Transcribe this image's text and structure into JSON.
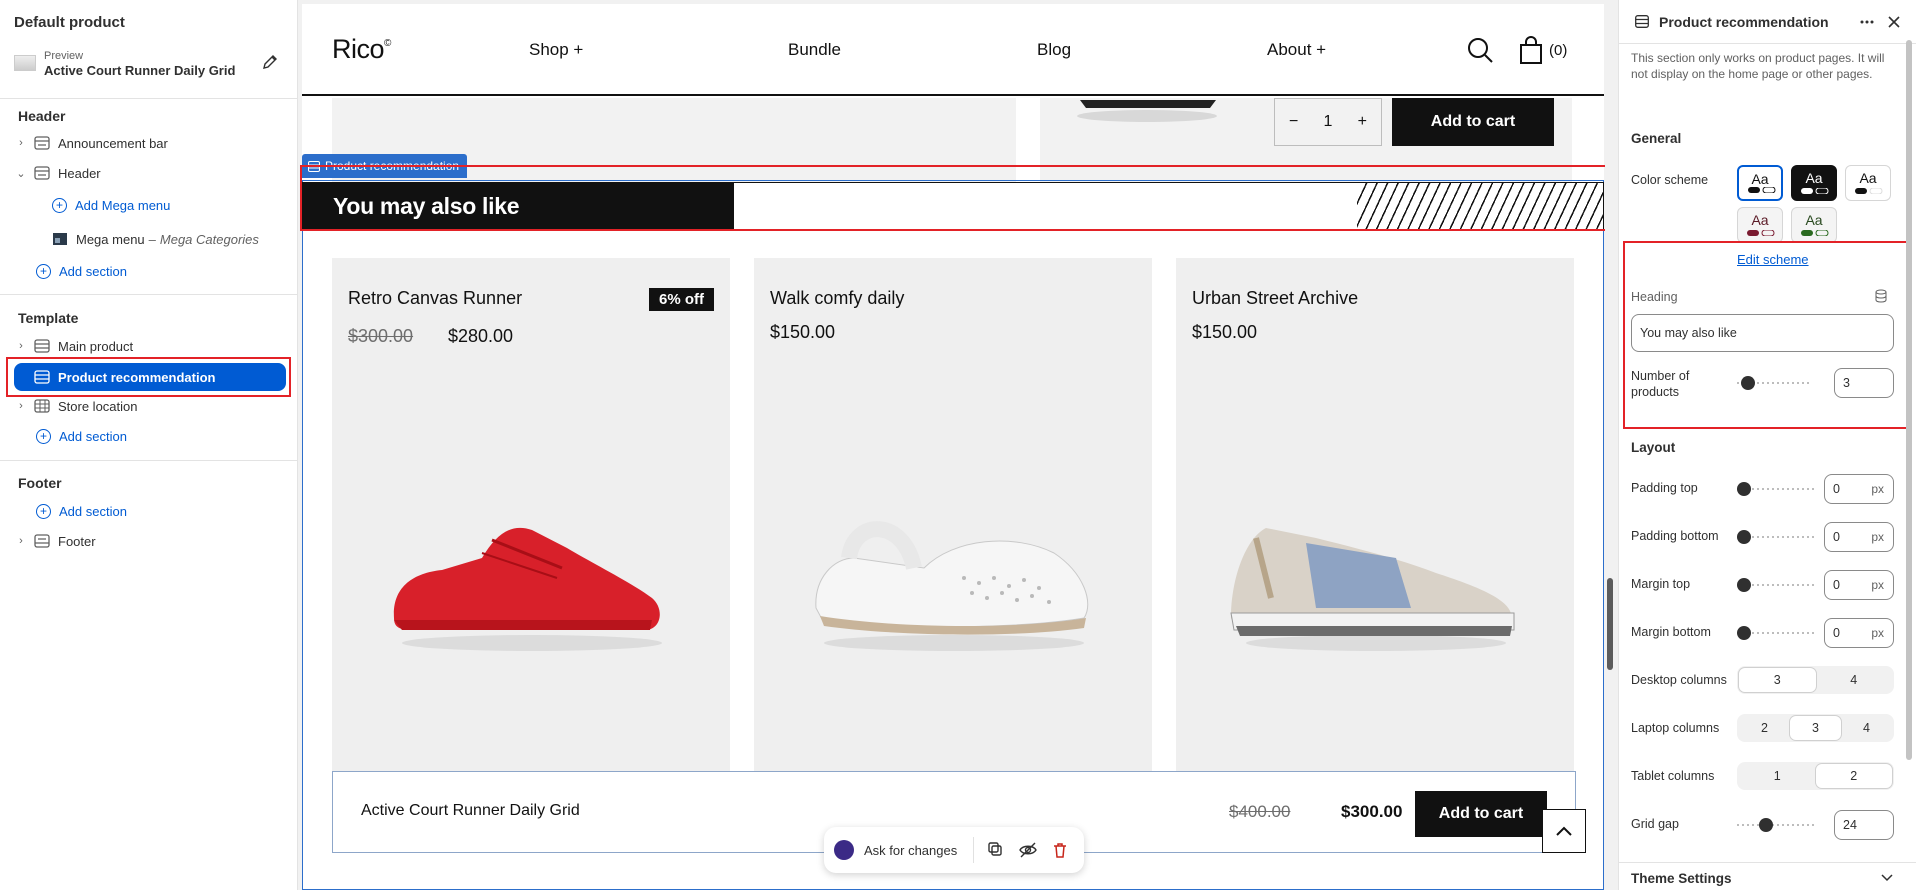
{
  "left_sidebar": {
    "product_title": "Default product",
    "preview_label": "Preview",
    "preview_value": "Active Court Runner Daily Grid",
    "groups": {
      "header": "Header",
      "template": "Template",
      "footer": "Footer"
    },
    "header_items": {
      "announcement_bar": "Announcement bar",
      "header": "Header",
      "add_mega_menu": "Add Mega menu",
      "mega_menu": "Mega menu",
      "mega_menu_sub": "Mega Categories",
      "add_section": "Add section"
    },
    "template_items": {
      "main_product": "Main product",
      "product_recommendation": "Product recommendation",
      "store_location": "Store location",
      "add_section": "Add section"
    },
    "footer_items": {
      "add_section": "Add section",
      "footer": "Footer"
    }
  },
  "store": {
    "logo": "Rico",
    "logo_mark": "©",
    "nav": [
      "Shop +",
      "Bundle",
      "Blog",
      "About +"
    ],
    "cart_count": "(0)",
    "prev_section": {
      "quantity": "1",
      "add_to_cart": "Add to cart"
    },
    "section_tag": "Product recommendation",
    "heading": "You may also like",
    "products": [
      {
        "name": "Retro Canvas Runner",
        "old_price": "$300.00",
        "price": "$280.00",
        "badge": "6% off",
        "image": "red-sneaker"
      },
      {
        "name": "Walk comfy daily",
        "price": "$150.00",
        "image": "white-clog"
      },
      {
        "name": "Urban Street Archive",
        "price": "$150.00",
        "image": "grey-blue-sneaker"
      }
    ],
    "sticky_bar": {
      "name": "Active Court Runner Daily Grid",
      "old_price": "$400.00",
      "price": "$300.00",
      "add_to_cart": "Add to cart"
    },
    "ask_bar": {
      "label": "Ask for changes"
    }
  },
  "right_panel": {
    "title": "Product recommendation",
    "notice": "This section only works on product pages. It will not display on the home page or other pages.",
    "general": "General",
    "color_scheme_label": "Color scheme",
    "swatch_text": "Aa",
    "edit_scheme": "Edit scheme",
    "heading_label": "Heading",
    "heading_value": "You may also like",
    "num_products_label": "Number of products",
    "num_products_value": "3",
    "layout": "Layout",
    "padding_top": {
      "label": "Padding top",
      "value": "0"
    },
    "padding_bottom": {
      "label": "Padding bottom",
      "value": "0"
    },
    "margin_top": {
      "label": "Margin top",
      "value": "0"
    },
    "margin_bottom": {
      "label": "Margin bottom",
      "value": "0"
    },
    "unit": "px",
    "desktop_columns": {
      "label": "Desktop columns",
      "options": [
        "3",
        "4"
      ],
      "selected": "3"
    },
    "laptop_columns": {
      "label": "Laptop columns",
      "options": [
        "2",
        "3",
        "4"
      ],
      "selected": "3"
    },
    "tablet_columns": {
      "label": "Tablet columns",
      "options": [
        "1",
        "2"
      ],
      "selected": "2"
    },
    "grid_gap": {
      "label": "Grid gap",
      "value": "24"
    },
    "theme_settings": "Theme Settings"
  },
  "colors": {
    "accent": "#005bd3",
    "section_outline": "#2c6ecb",
    "highlight": "#e32227",
    "dark": "#111111"
  }
}
